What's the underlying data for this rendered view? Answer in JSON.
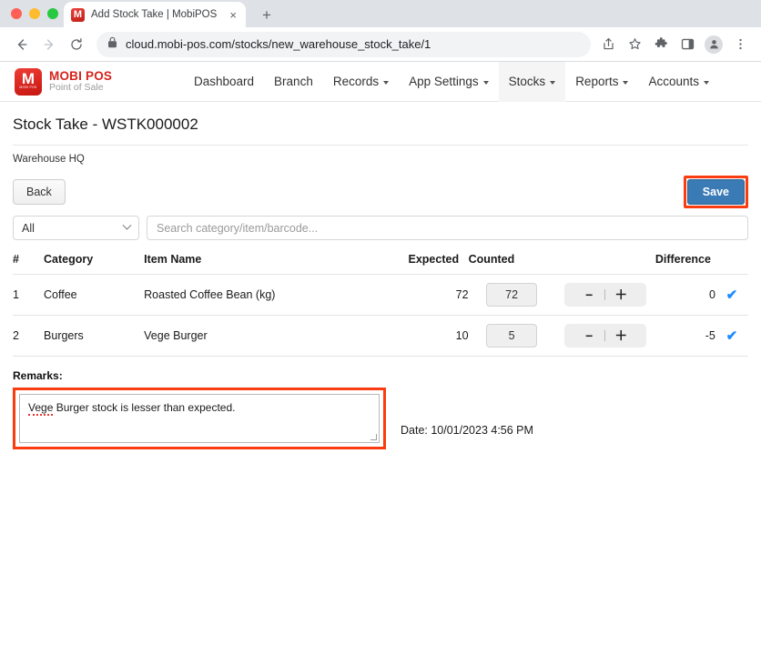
{
  "browser": {
    "tab": {
      "title": "Add Stock Take | MobiPOS",
      "favicon_letter": "M",
      "close_label": "×"
    },
    "new_tab_label": "+",
    "nav": {
      "back": "←",
      "forward": "→",
      "reload": "⟳"
    },
    "omnibox": {
      "lock_icon": "lock-icon",
      "url": "cloud.mobi-pos.com/stocks/new_warehouse_stock_take/1"
    },
    "toolbar_icons": [
      "share-icon",
      "bookmark-star-icon",
      "extensions-puzzle-icon",
      "side-panel-icon",
      "profile-avatar-icon",
      "chrome-menu-icon"
    ]
  },
  "site": {
    "brand": {
      "mark_letter": "M",
      "mark_sub": "MOBI POS",
      "name": "MOBI POS",
      "tagline": "Point of Sale"
    },
    "nav_items": [
      {
        "label": "Dashboard",
        "caret": false,
        "active": false
      },
      {
        "label": "Branch",
        "caret": false,
        "active": false
      },
      {
        "label": "Records",
        "caret": true,
        "active": false
      },
      {
        "label": "App Settings",
        "caret": true,
        "active": false
      },
      {
        "label": "Stocks",
        "caret": true,
        "active": true
      },
      {
        "label": "Reports",
        "caret": true,
        "active": false
      },
      {
        "label": "Accounts",
        "caret": true,
        "active": false
      }
    ]
  },
  "page": {
    "title": "Stock Take - WSTK000002",
    "subtitle": "Warehouse HQ",
    "back_label": "Back",
    "save_label": "Save",
    "category_filter": {
      "value": "All"
    },
    "search": {
      "placeholder": "Search category/item/barcode...",
      "value": ""
    }
  },
  "table": {
    "headers": {
      "index": "#",
      "category": "Category",
      "item_name": "Item Name",
      "expected": "Expected",
      "counted": "Counted",
      "difference": "Difference"
    },
    "stepper": {
      "minus": "−",
      "plus": "＋",
      "divider": "|"
    },
    "confirm_icon": "✔",
    "rows": [
      {
        "index": "1",
        "category": "Coffee",
        "item_name": "Roasted Coffee Bean (kg)",
        "expected": "72",
        "counted": "72",
        "difference": "0",
        "difference_negative": false
      },
      {
        "index": "2",
        "category": "Burgers",
        "item_name": "Vege Burger",
        "expected": "10",
        "counted": "5",
        "difference": "-5",
        "difference_negative": true
      }
    ]
  },
  "remarks": {
    "label": "Remarks:",
    "misspelled_word": "Vege",
    "value_rest": " Burger stock is lesser than expected.",
    "full_value": "Vege Burger stock is lesser than expected."
  },
  "date": {
    "text": "Date: 10/01/2023 4:56 PM"
  },
  "colors": {
    "brand_red": "#d5231c",
    "save_blue": "#3a7ab5",
    "annotation_red": "#fa3c10",
    "difference_negative": "#e0281f",
    "check_blue": "#1a8cff"
  }
}
